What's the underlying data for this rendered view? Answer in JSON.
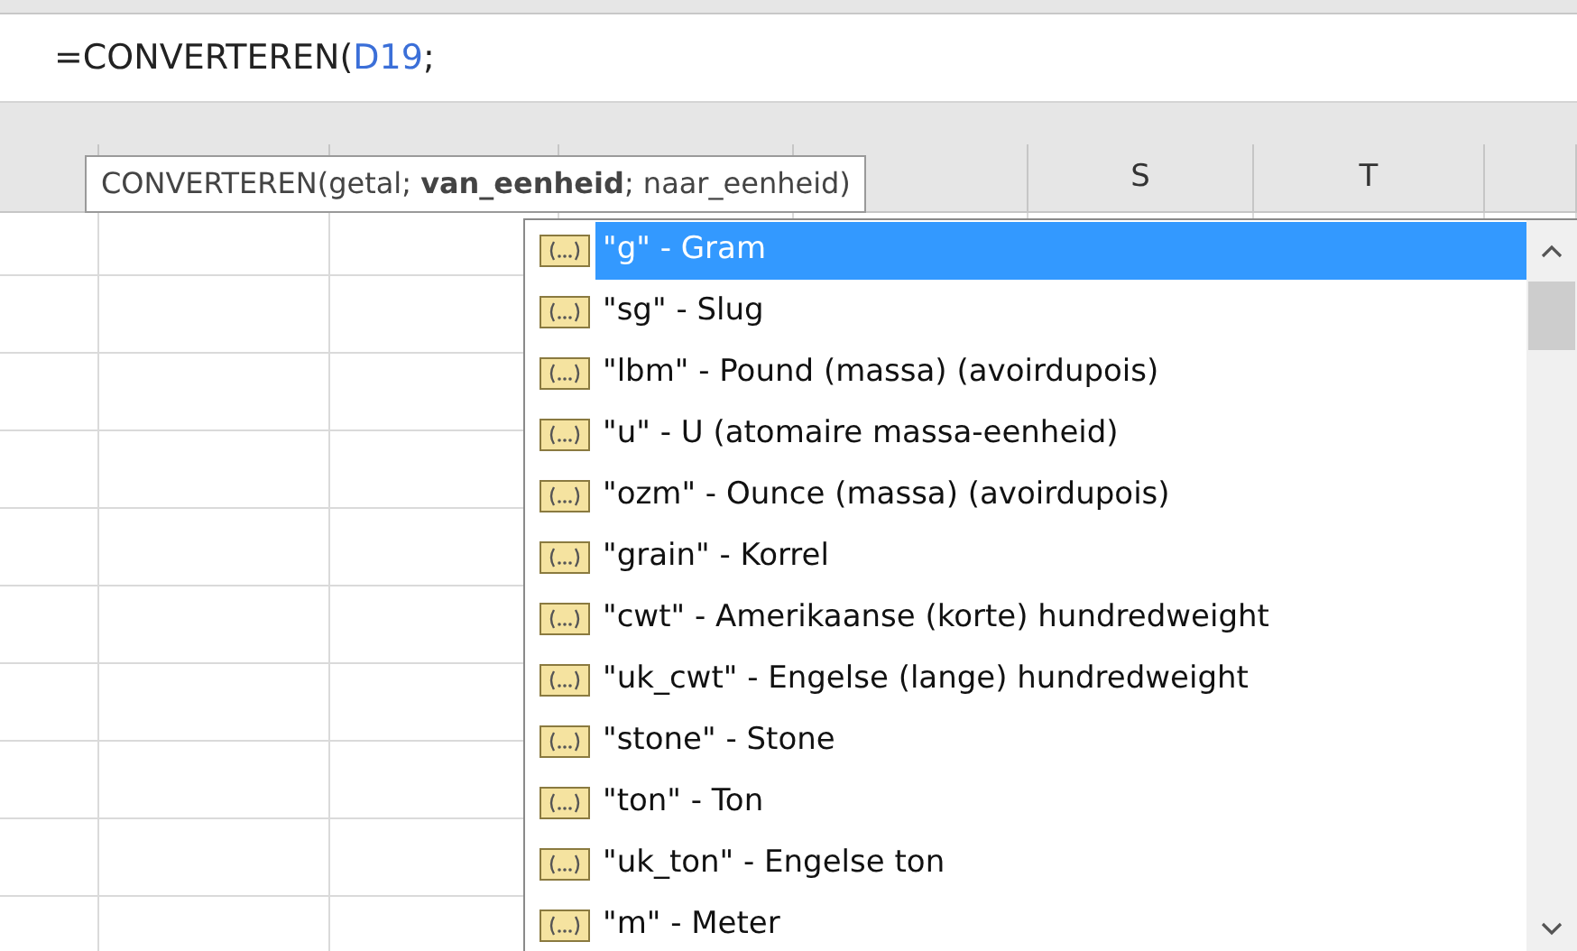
{
  "formula_bar": {
    "parts": [
      {
        "text": "=CONVERTEREN(",
        "kind": "plain"
      },
      {
        "text": "D19",
        "kind": "reference"
      },
      {
        "text": ";",
        "kind": "plain"
      }
    ]
  },
  "column_headers": [
    {
      "label": "S"
    },
    {
      "label": "T"
    }
  ],
  "tooltip": {
    "text": "CONVERTEREN(getal; **van_eenheid**; naar_eenheid)"
  },
  "dropdown": {
    "items": [
      {
        "label": "\"g\" - Gram",
        "selected": true
      },
      {
        "label": "\"sg\" - Slug",
        "selected": false
      },
      {
        "label": "\"lbm\" - Pound (massa) (avoirdupois)",
        "selected": false
      },
      {
        "label": "\"u\" - U (atomaire massa-eenheid)",
        "selected": false
      },
      {
        "label": "\"ozm\" - Ounce (massa) (avoirdupois)",
        "selected": false
      },
      {
        "label": "\"grain\" - Korrel",
        "selected": false
      },
      {
        "label": "\"cwt\" - Amerikaanse (korte) hundredweight",
        "selected": false
      },
      {
        "label": "\"uk_cwt\" - Engelse (lange) hundredweight",
        "selected": false
      },
      {
        "label": "\"stone\" - Stone",
        "selected": false
      },
      {
        "label": "\"ton\" - Ton",
        "selected": false
      },
      {
        "label": "\"uk_ton\" - Engelse ton",
        "selected": false
      },
      {
        "label": "\"m\" - Meter",
        "selected": false
      }
    ]
  }
}
